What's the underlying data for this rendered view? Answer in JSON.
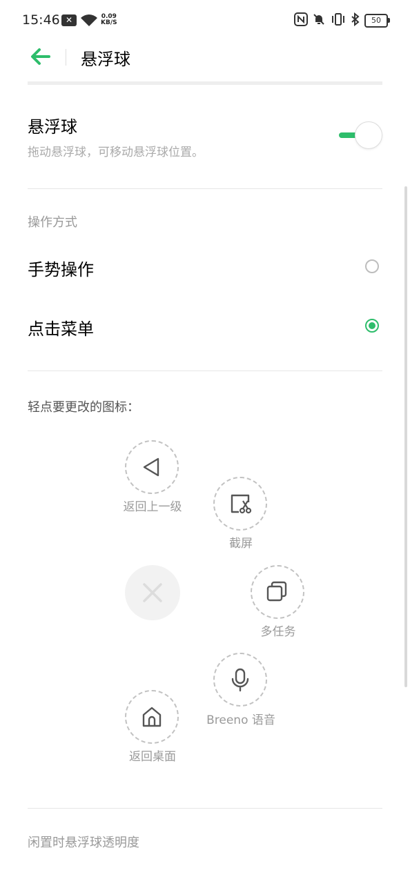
{
  "status_bar": {
    "time": "15:46",
    "net_speed_value": "0.09",
    "net_speed_unit": "KB/S",
    "battery": "50"
  },
  "header": {
    "title": "悬浮球",
    "back_icon": "arrow-left-icon",
    "accent_color": "#2ebd6b"
  },
  "float_ball": {
    "title": "悬浮球",
    "subtitle": "拖动悬浮球，可移动悬浮球位置。",
    "enabled": true
  },
  "operation": {
    "section_label": "操作方式",
    "options": [
      {
        "label": "手势操作",
        "selected": false
      },
      {
        "label": "点击菜单",
        "selected": true
      }
    ]
  },
  "menu_editor": {
    "instruction": "轻点要更改的图标：",
    "items": [
      {
        "label": "返回上一级",
        "icon": "back-triangle-icon"
      },
      {
        "label": "截屏",
        "icon": "screenshot-icon"
      },
      {
        "label": "多任务",
        "icon": "multitask-icon"
      },
      {
        "label": "Breeno 语音",
        "icon": "microphone-icon"
      },
      {
        "label": "返回桌面",
        "icon": "home-icon"
      }
    ],
    "close_icon": "close-icon"
  },
  "idle_opacity": {
    "label": "闲置时悬浮球透明度"
  }
}
